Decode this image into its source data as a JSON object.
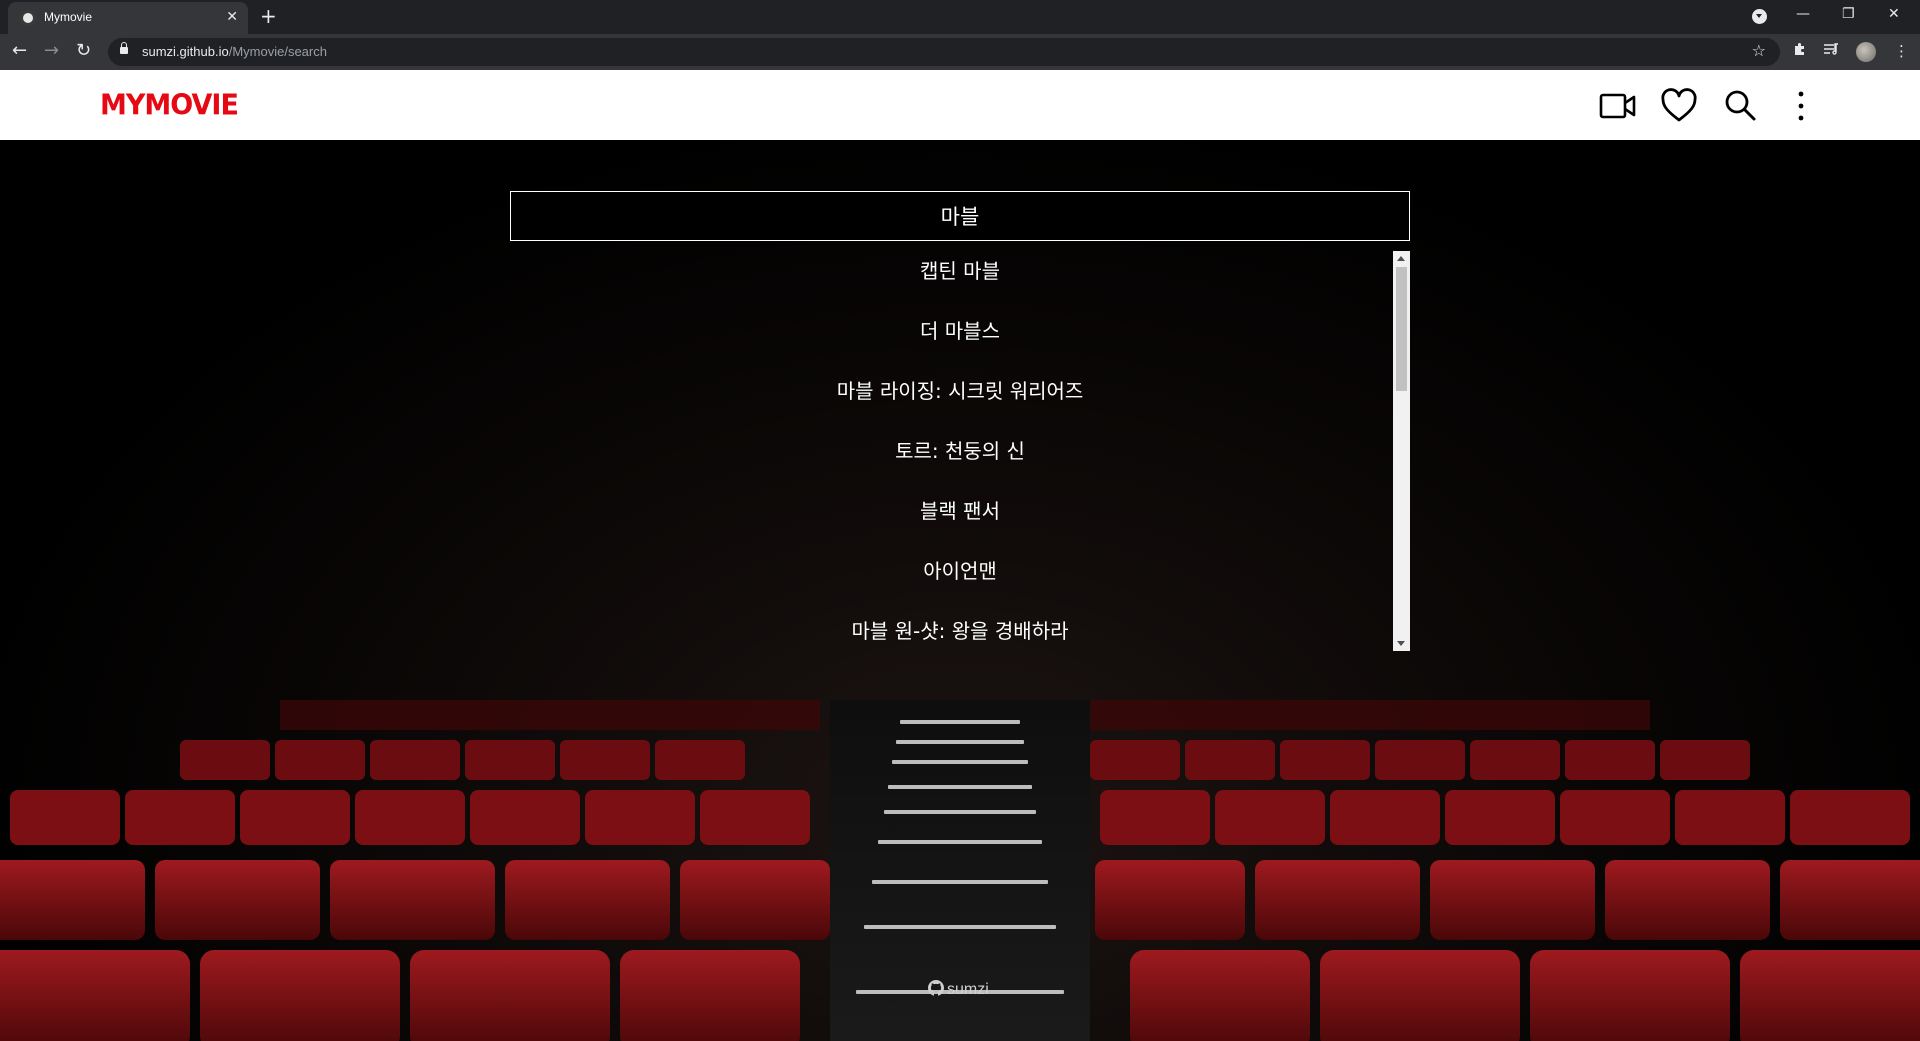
{
  "browser": {
    "tab_title": "Mymovie",
    "tab_close": "✕",
    "new_tab": "+",
    "url_host": "sumzi.github.io",
    "url_path": "/Mymovie/search",
    "window_controls": {
      "minimize": "—",
      "restore": "❐",
      "close": "✕"
    }
  },
  "header": {
    "logo": "MYMOVIE",
    "icons": [
      "video-camera-icon",
      "heart-icon",
      "search-icon",
      "more-vertical-icon"
    ]
  },
  "search": {
    "query": "마블",
    "results": [
      "캡틴 마블",
      "더 마블스",
      "마블 라이징: 시크릿 워리어즈",
      "토르: 천둥의 신",
      "블랙 팬서",
      "아이언맨",
      "마블 원-샷: 왕을 경배하라"
    ]
  },
  "footer": {
    "credit": "sumzi",
    "icon": "github-icon"
  },
  "colors": {
    "brand": "#e50914",
    "header_bg": "#ffffff",
    "page_bg": "#000000",
    "seat_red": "#8b1217"
  }
}
